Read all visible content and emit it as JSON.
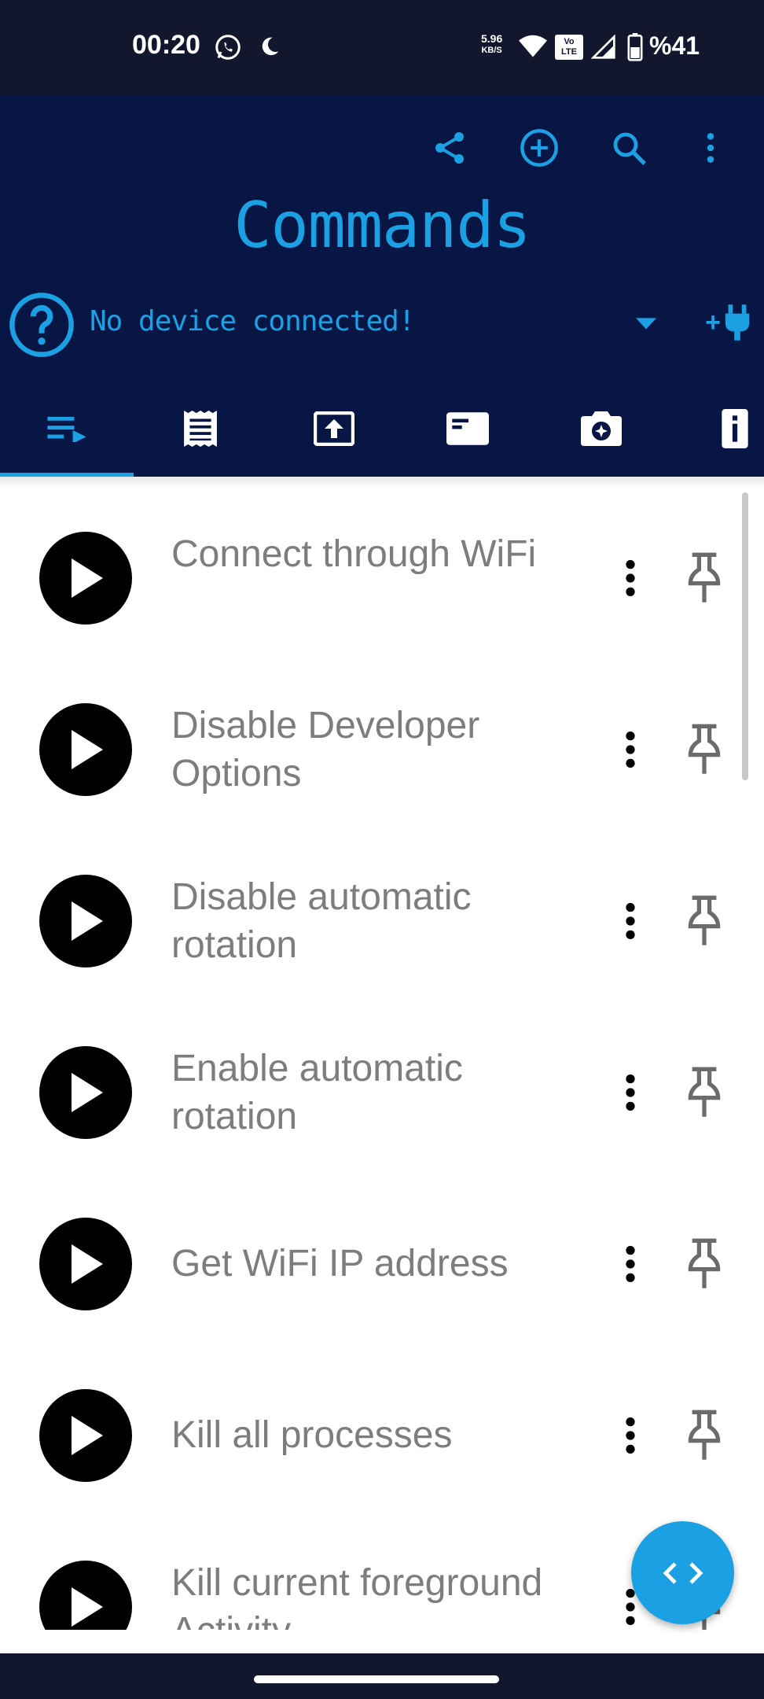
{
  "status_bar": {
    "time": "00:20",
    "speed_value": "5.96",
    "speed_unit": "KB/S",
    "volte": "Vo LTE",
    "battery": "%41",
    "icons": [
      "whatsapp-icon",
      "moon-icon",
      "wifi-icon",
      "volte-icon",
      "signal-icon",
      "battery-icon"
    ]
  },
  "app_bar": {
    "title": "Commands",
    "actions": [
      "share-icon",
      "add-icon",
      "search-icon",
      "more-vert-icon"
    ]
  },
  "device": {
    "status": "No device connected!",
    "connect_badge": "+"
  },
  "tabs": [
    {
      "icon": "playlist-icon",
      "selected": true
    },
    {
      "icon": "receipt-icon",
      "selected": false
    },
    {
      "icon": "upload-icon",
      "selected": false
    },
    {
      "icon": "card-icon",
      "selected": false
    },
    {
      "icon": "camera-icon",
      "selected": false
    },
    {
      "icon": "info-icon",
      "selected": false
    }
  ],
  "commands": [
    {
      "title": "Connect through WiFi"
    },
    {
      "title": "Disable Developer Options"
    },
    {
      "title": "Disable automatic rotation"
    },
    {
      "title": "Enable automatic rotation"
    },
    {
      "title": "Get WiFi IP address"
    },
    {
      "title": "Kill all processes"
    },
    {
      "title": "Kill current foreground Activity"
    }
  ],
  "fab": {
    "icon": "code-icon"
  },
  "colors": {
    "accent": "#1aa0e3",
    "app_bar": "#071645",
    "status_bar": "#13172e",
    "item_text": "#7d7d7d"
  }
}
